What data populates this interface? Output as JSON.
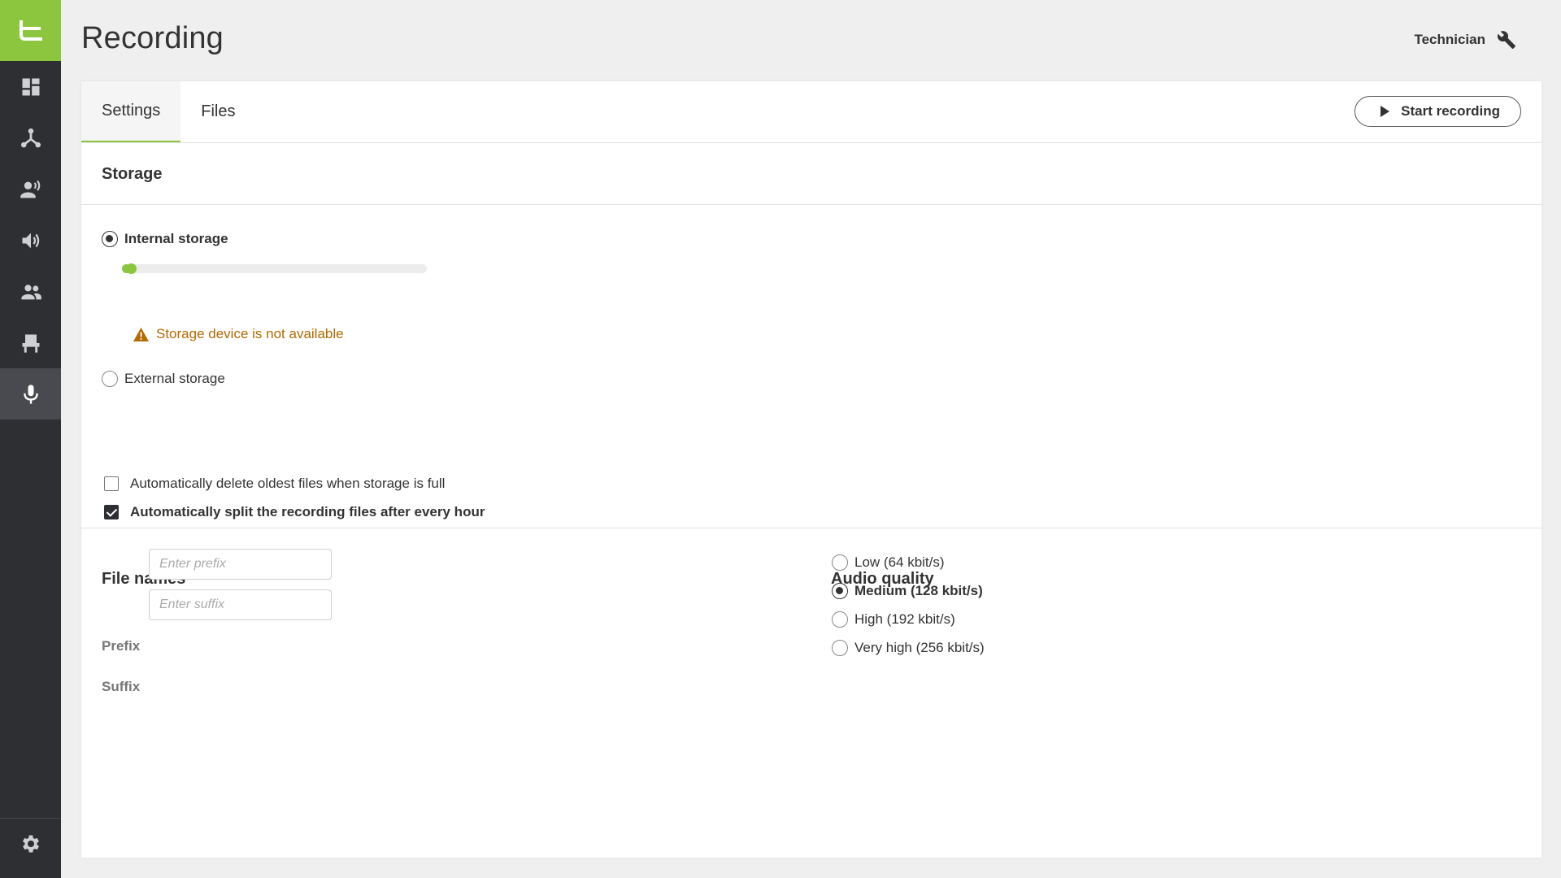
{
  "sidebar": {
    "logo": "teufel-logo",
    "items": [
      {
        "icon": "dashboard-icon"
      },
      {
        "icon": "network-icon"
      },
      {
        "icon": "announcer-icon"
      },
      {
        "icon": "speaker-icon"
      },
      {
        "icon": "users-icon"
      },
      {
        "icon": "seat-icon"
      },
      {
        "icon": "microphone-icon",
        "active": true
      }
    ],
    "settings_icon": "gear-icon"
  },
  "header": {
    "title": "Recording",
    "user_label": "Technician",
    "user_icon": "wrench-icon"
  },
  "tabs": [
    {
      "label": "Settings",
      "active": true
    },
    {
      "label": "Files",
      "active": false
    }
  ],
  "start_button": {
    "label": "Start recording",
    "icon": "play-icon"
  },
  "storage": {
    "heading": "Storage",
    "internal_label": "Internal storage",
    "internal_selected": true,
    "usage_fraction": 0.03,
    "external_label": "External storage",
    "external_selected": false,
    "warning": "Storage device is not available",
    "warning_icon": "warning-icon",
    "auto_delete_label": "Automatically delete oldest files when storage is full",
    "auto_delete_checked": false,
    "auto_split_label": "Automatically split the recording files after every hour",
    "auto_split_checked": true
  },
  "file_names": {
    "heading": "File names",
    "prefix_label": "Prefix",
    "prefix_value": "",
    "prefix_placeholder": "Enter prefix",
    "suffix_label": "Suffix",
    "suffix_value": "",
    "suffix_placeholder": "Enter suffix"
  },
  "audio_quality": {
    "heading": "Audio quality",
    "options": [
      {
        "label": "Low (64 kbit/s)",
        "selected": false
      },
      {
        "label": "Medium (128 kbit/s)",
        "selected": true
      },
      {
        "label": "High (192 kbit/s)",
        "selected": false
      },
      {
        "label": "Very high (256 kbit/s)",
        "selected": false
      }
    ]
  },
  "colors": {
    "accent": "#8cc63f",
    "sidebar": "#2d2f33",
    "warning": "#b36a00"
  }
}
